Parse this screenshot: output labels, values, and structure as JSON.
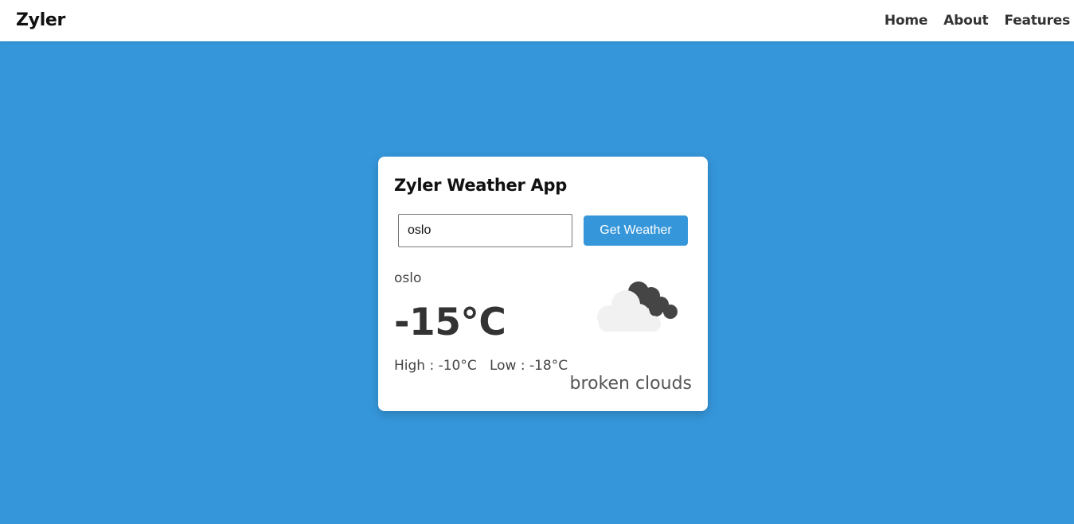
{
  "nav": {
    "brand": "Zyler",
    "links": [
      "Home",
      "About",
      "Features"
    ]
  },
  "card": {
    "title": "Zyler Weather App",
    "input_value": "oslo",
    "button_label": "Get Weather",
    "city": "oslo",
    "temperature": "-15°C",
    "high_low": "High : -10°C   Low : -18°C",
    "description": "broken clouds",
    "icon": "broken-clouds-icon"
  },
  "colors": {
    "background": "#3596da",
    "accent": "#3596da",
    "card": "#ffffff",
    "navbar": "#ffffff"
  }
}
